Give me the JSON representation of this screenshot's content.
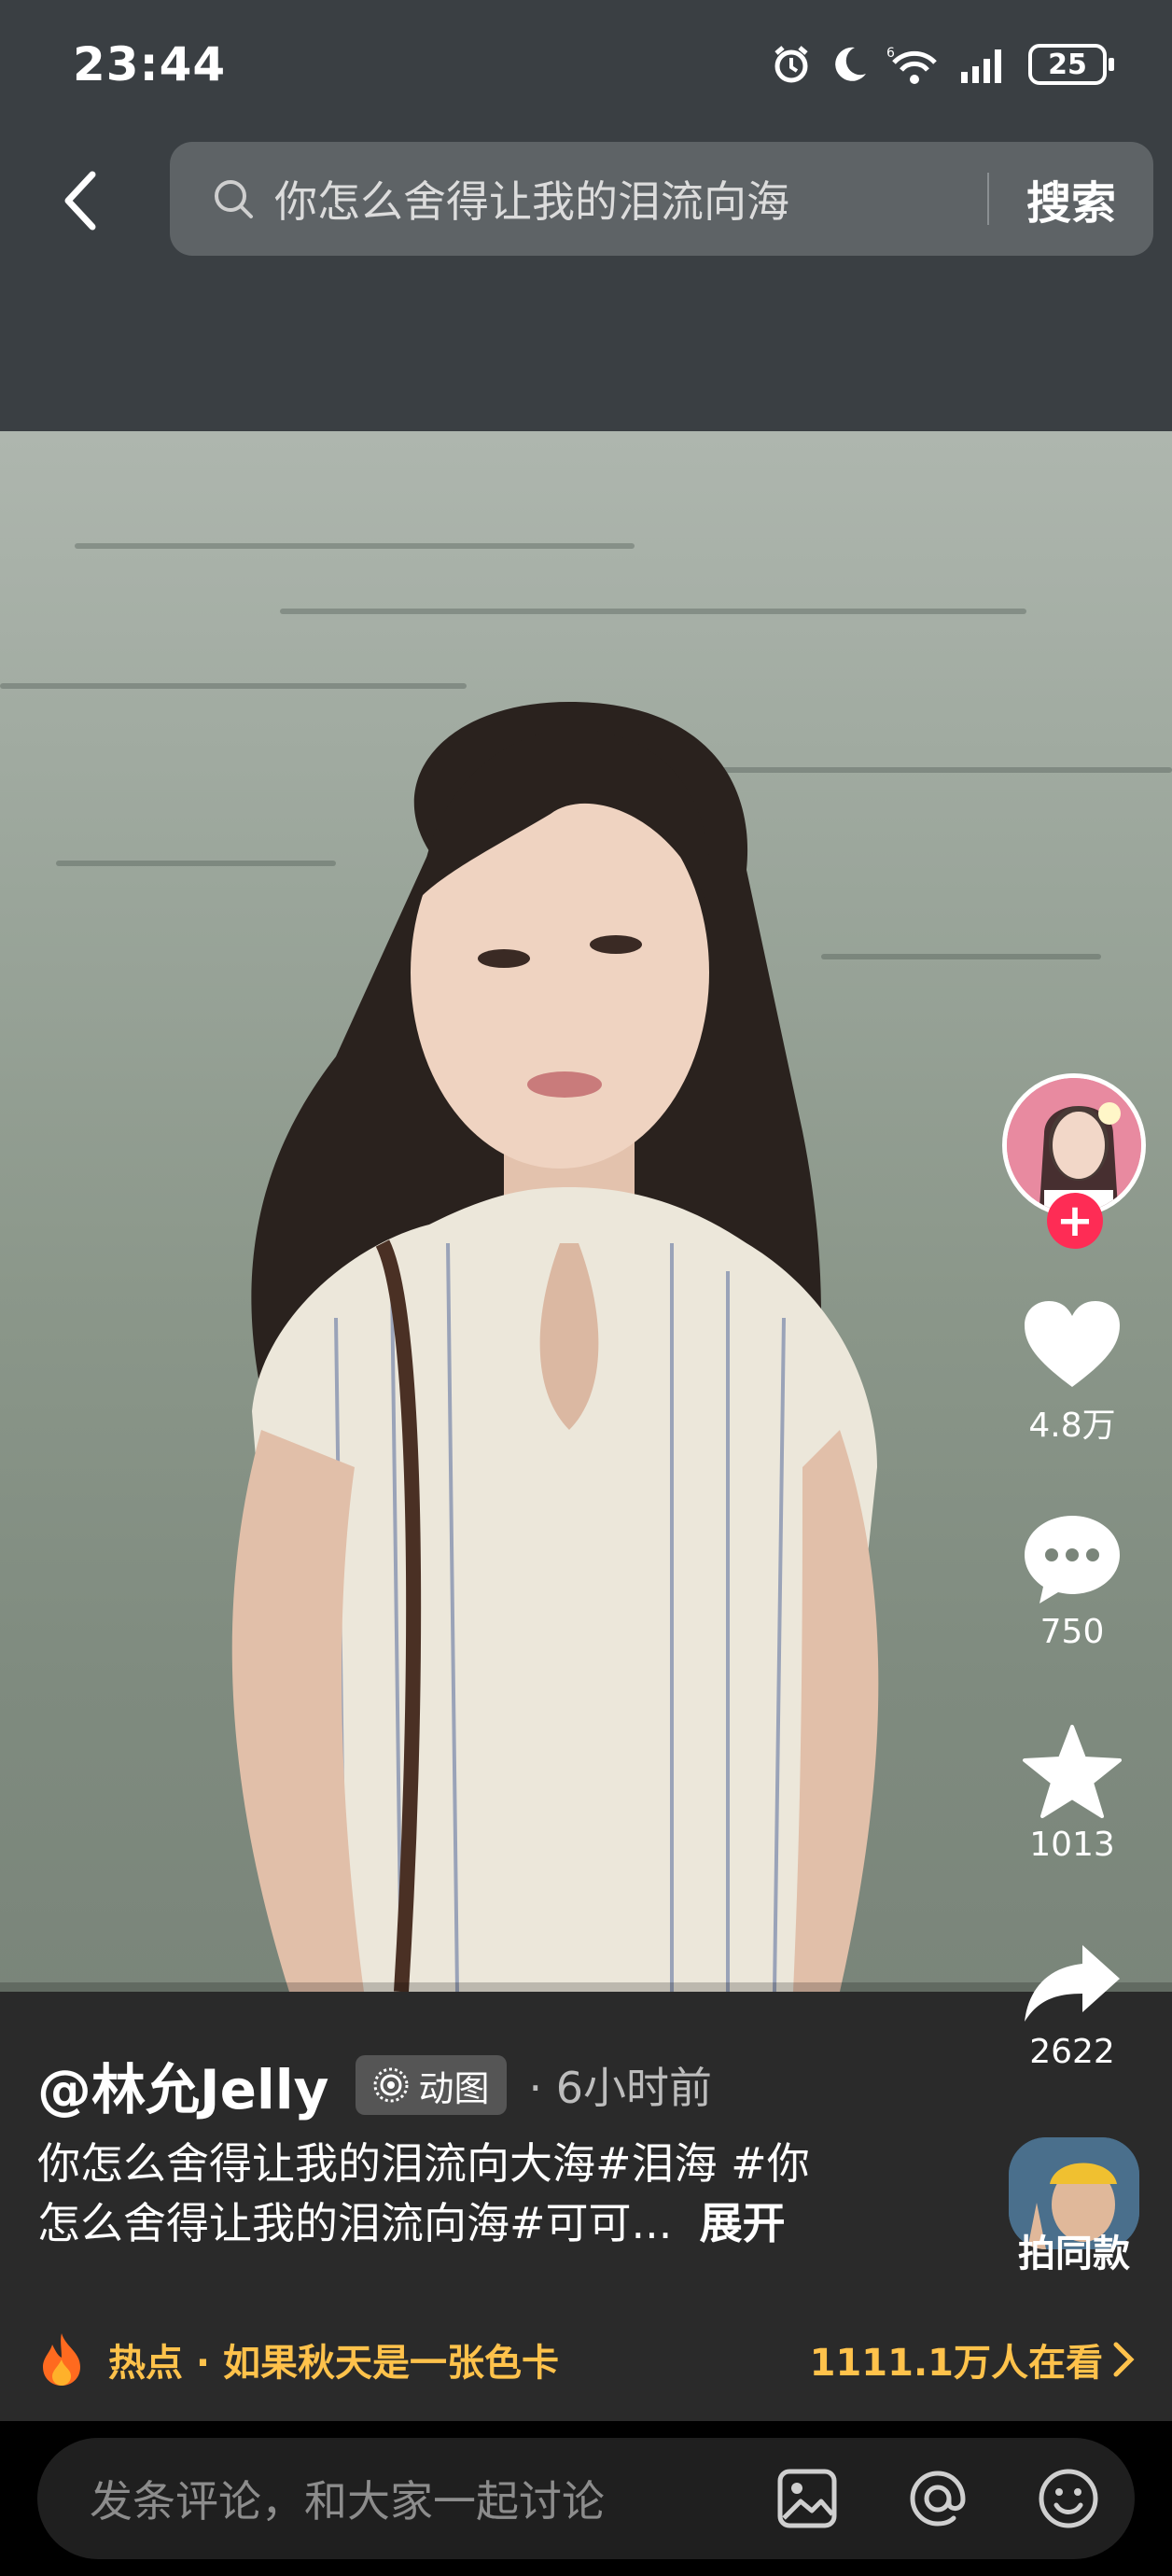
{
  "status_bar": {
    "time": "23:44",
    "battery": "25",
    "network": "6"
  },
  "search": {
    "query": "你怎么舍得让我的泪流向海",
    "button_label": "搜索"
  },
  "actions": {
    "like_count": "4.8万",
    "comment_count": "750",
    "favorite_count": "1013",
    "share_count": "2622",
    "follow_symbol": "+"
  },
  "post": {
    "author": "@林允Jelly",
    "tag_label": "动图",
    "time_ago": "· 6小时前",
    "caption_line1": "你怎么舍得让我的泪流向大海#泪海 #你",
    "caption_line2": "怎么舍得让我的泪流向海#可可...",
    "expand_label": "展开",
    "same_style_label": "拍同款"
  },
  "hot": {
    "label": "热点 · 如果秋天是一张色卡",
    "viewers": "1111.1万人在看"
  },
  "comment_bar": {
    "placeholder": "发条评论，和大家一起讨论"
  },
  "colors": {
    "accent_red": "#fe2c55",
    "hot_yellow": "#ffc24b",
    "top_bg": "#3a3f43",
    "panel_bg": "#2a2a2a"
  },
  "icons": [
    "back-arrow-icon",
    "search-icon",
    "heart-icon",
    "comment-icon",
    "star-icon",
    "share-icon",
    "fire-icon",
    "image-icon",
    "at-icon",
    "emoji-icon",
    "alarm-icon",
    "moon-icon",
    "wifi-icon",
    "signal-icon"
  ]
}
